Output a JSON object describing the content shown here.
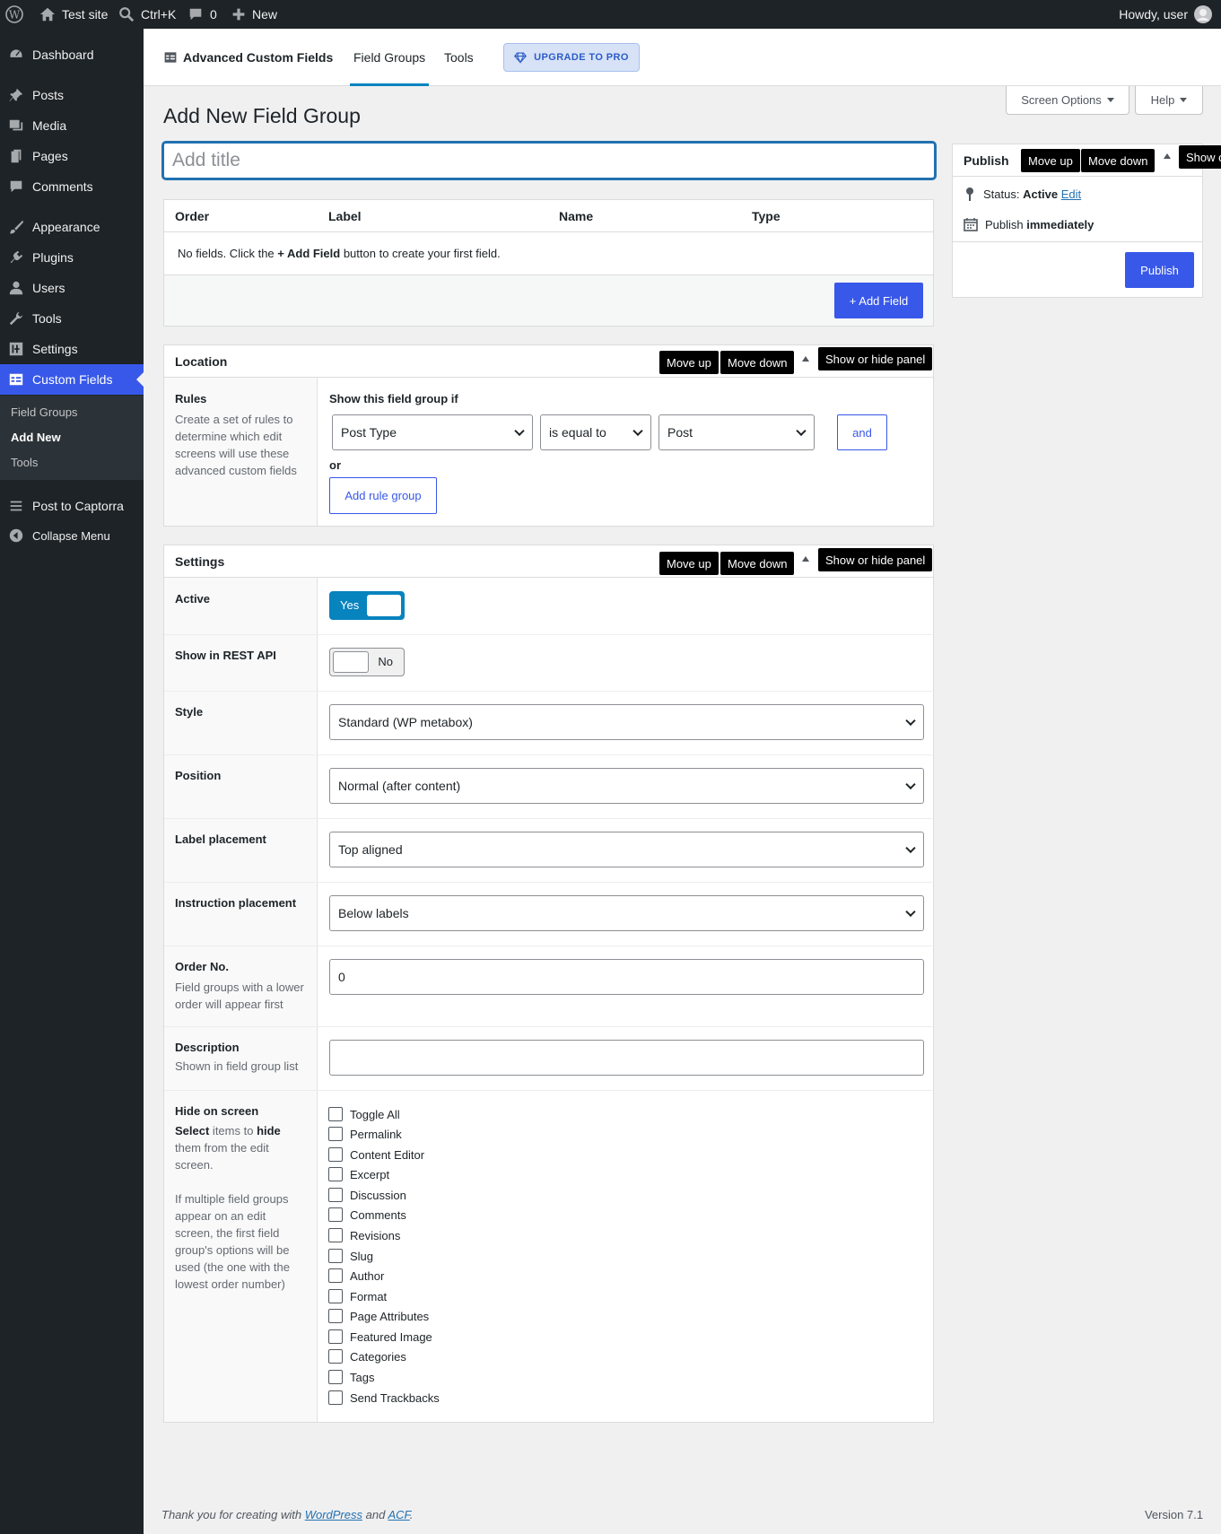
{
  "admin_bar": {
    "site_name": "Test site",
    "search_shortcut": "Ctrl+K",
    "comments_count": "0",
    "new_label": "New",
    "greeting": "Howdy, user"
  },
  "sidebar": {
    "items": [
      {
        "label": "Dashboard",
        "icon": "dashboard-icon"
      },
      {
        "label": "Posts",
        "icon": "pin-icon"
      },
      {
        "label": "Media",
        "icon": "media-icon"
      },
      {
        "label": "Pages",
        "icon": "pages-icon"
      },
      {
        "label": "Comments",
        "icon": "comment-icon"
      },
      {
        "label": "Appearance",
        "icon": "brush-icon"
      },
      {
        "label": "Plugins",
        "icon": "plugin-icon"
      },
      {
        "label": "Users",
        "icon": "user-icon"
      },
      {
        "label": "Tools",
        "icon": "wrench-icon"
      },
      {
        "label": "Settings",
        "icon": "settings-icon"
      },
      {
        "label": "Custom Fields",
        "icon": "table-icon"
      },
      {
        "label": "Post to Captorra",
        "icon": "menu-icon"
      },
      {
        "label": "Collapse Menu",
        "icon": "collapse-icon"
      }
    ],
    "submenu": [
      "Field Groups",
      "Add New",
      "Tools"
    ]
  },
  "acf_header": {
    "brand": "Advanced Custom Fields",
    "tab_field_groups": "Field Groups",
    "tab_tools": "Tools",
    "upgrade": "UPGRADE TO PRO"
  },
  "screen_options": "Screen Options",
  "help": "Help",
  "page_title": "Add New Field Group",
  "title_placeholder": "Add title",
  "fields_table": {
    "columns": [
      "Order",
      "Label",
      "Name",
      "Type"
    ],
    "empty_pre": "No fields. Click the ",
    "empty_bold": "+ Add Field",
    "empty_post": " button to create your first field.",
    "add_field": "+ Add Field"
  },
  "tooltips": {
    "move_up": "Move up",
    "move_down": "Move down",
    "toggle": "Show or hide panel",
    "toggle_cut": "Show o"
  },
  "location": {
    "title": "Location",
    "rules_label": "Rules",
    "rules_desc": "Create a set of rules to determine which edit screens will use these advanced custom fields",
    "show_if": "Show this field group if",
    "param": "Post Type",
    "operator": "is equal to",
    "value": "Post",
    "and": "and",
    "or": "or",
    "add_rule_group": "Add rule group"
  },
  "settings": {
    "title": "Settings",
    "active_label": "Active",
    "active_value": "Yes",
    "rest_label": "Show in REST API",
    "rest_value": "No",
    "style_label": "Style",
    "style_value": "Standard (WP metabox)",
    "position_label": "Position",
    "position_value": "Normal (after content)",
    "label_placement_label": "Label placement",
    "label_placement_value": "Top aligned",
    "instruction_label": "Instruction placement",
    "instruction_value": "Below labels",
    "order_label": "Order No.",
    "order_desc": "Field groups with a lower order will appear first",
    "order_value": "0",
    "description_label": "Description",
    "description_desc": "Shown in field group list",
    "hide_label": "Hide on screen",
    "hide_desc_1a": "Select",
    "hide_desc_1b": " items to ",
    "hide_desc_1c": "hide",
    "hide_desc_1d": " them from the edit screen.",
    "hide_desc_2": "If multiple field groups appear on an edit screen, the first field group's options will be used (the one with the lowest order number)",
    "hide_items": [
      "Toggle All",
      "Permalink",
      "Content Editor",
      "Excerpt",
      "Discussion",
      "Comments",
      "Revisions",
      "Slug",
      "Author",
      "Format",
      "Page Attributes",
      "Featured Image",
      "Categories",
      "Tags",
      "Send Trackbacks"
    ]
  },
  "publish": {
    "title": "Publish",
    "status_prefix": "Status: ",
    "status_value": "Active",
    "edit": "Edit",
    "publish_prefix": "Publish ",
    "publish_value": "immediately",
    "button": "Publish"
  },
  "footer": {
    "pre": "Thank you for creating with ",
    "wp": "WordPress",
    "and": " and ",
    "acf": "ACF",
    "dot": ".",
    "version": "Version 7.1"
  },
  "colors": {
    "accent": "#3858e9",
    "admin_bar": "#1d2327",
    "toggle_on": "#0783be"
  }
}
